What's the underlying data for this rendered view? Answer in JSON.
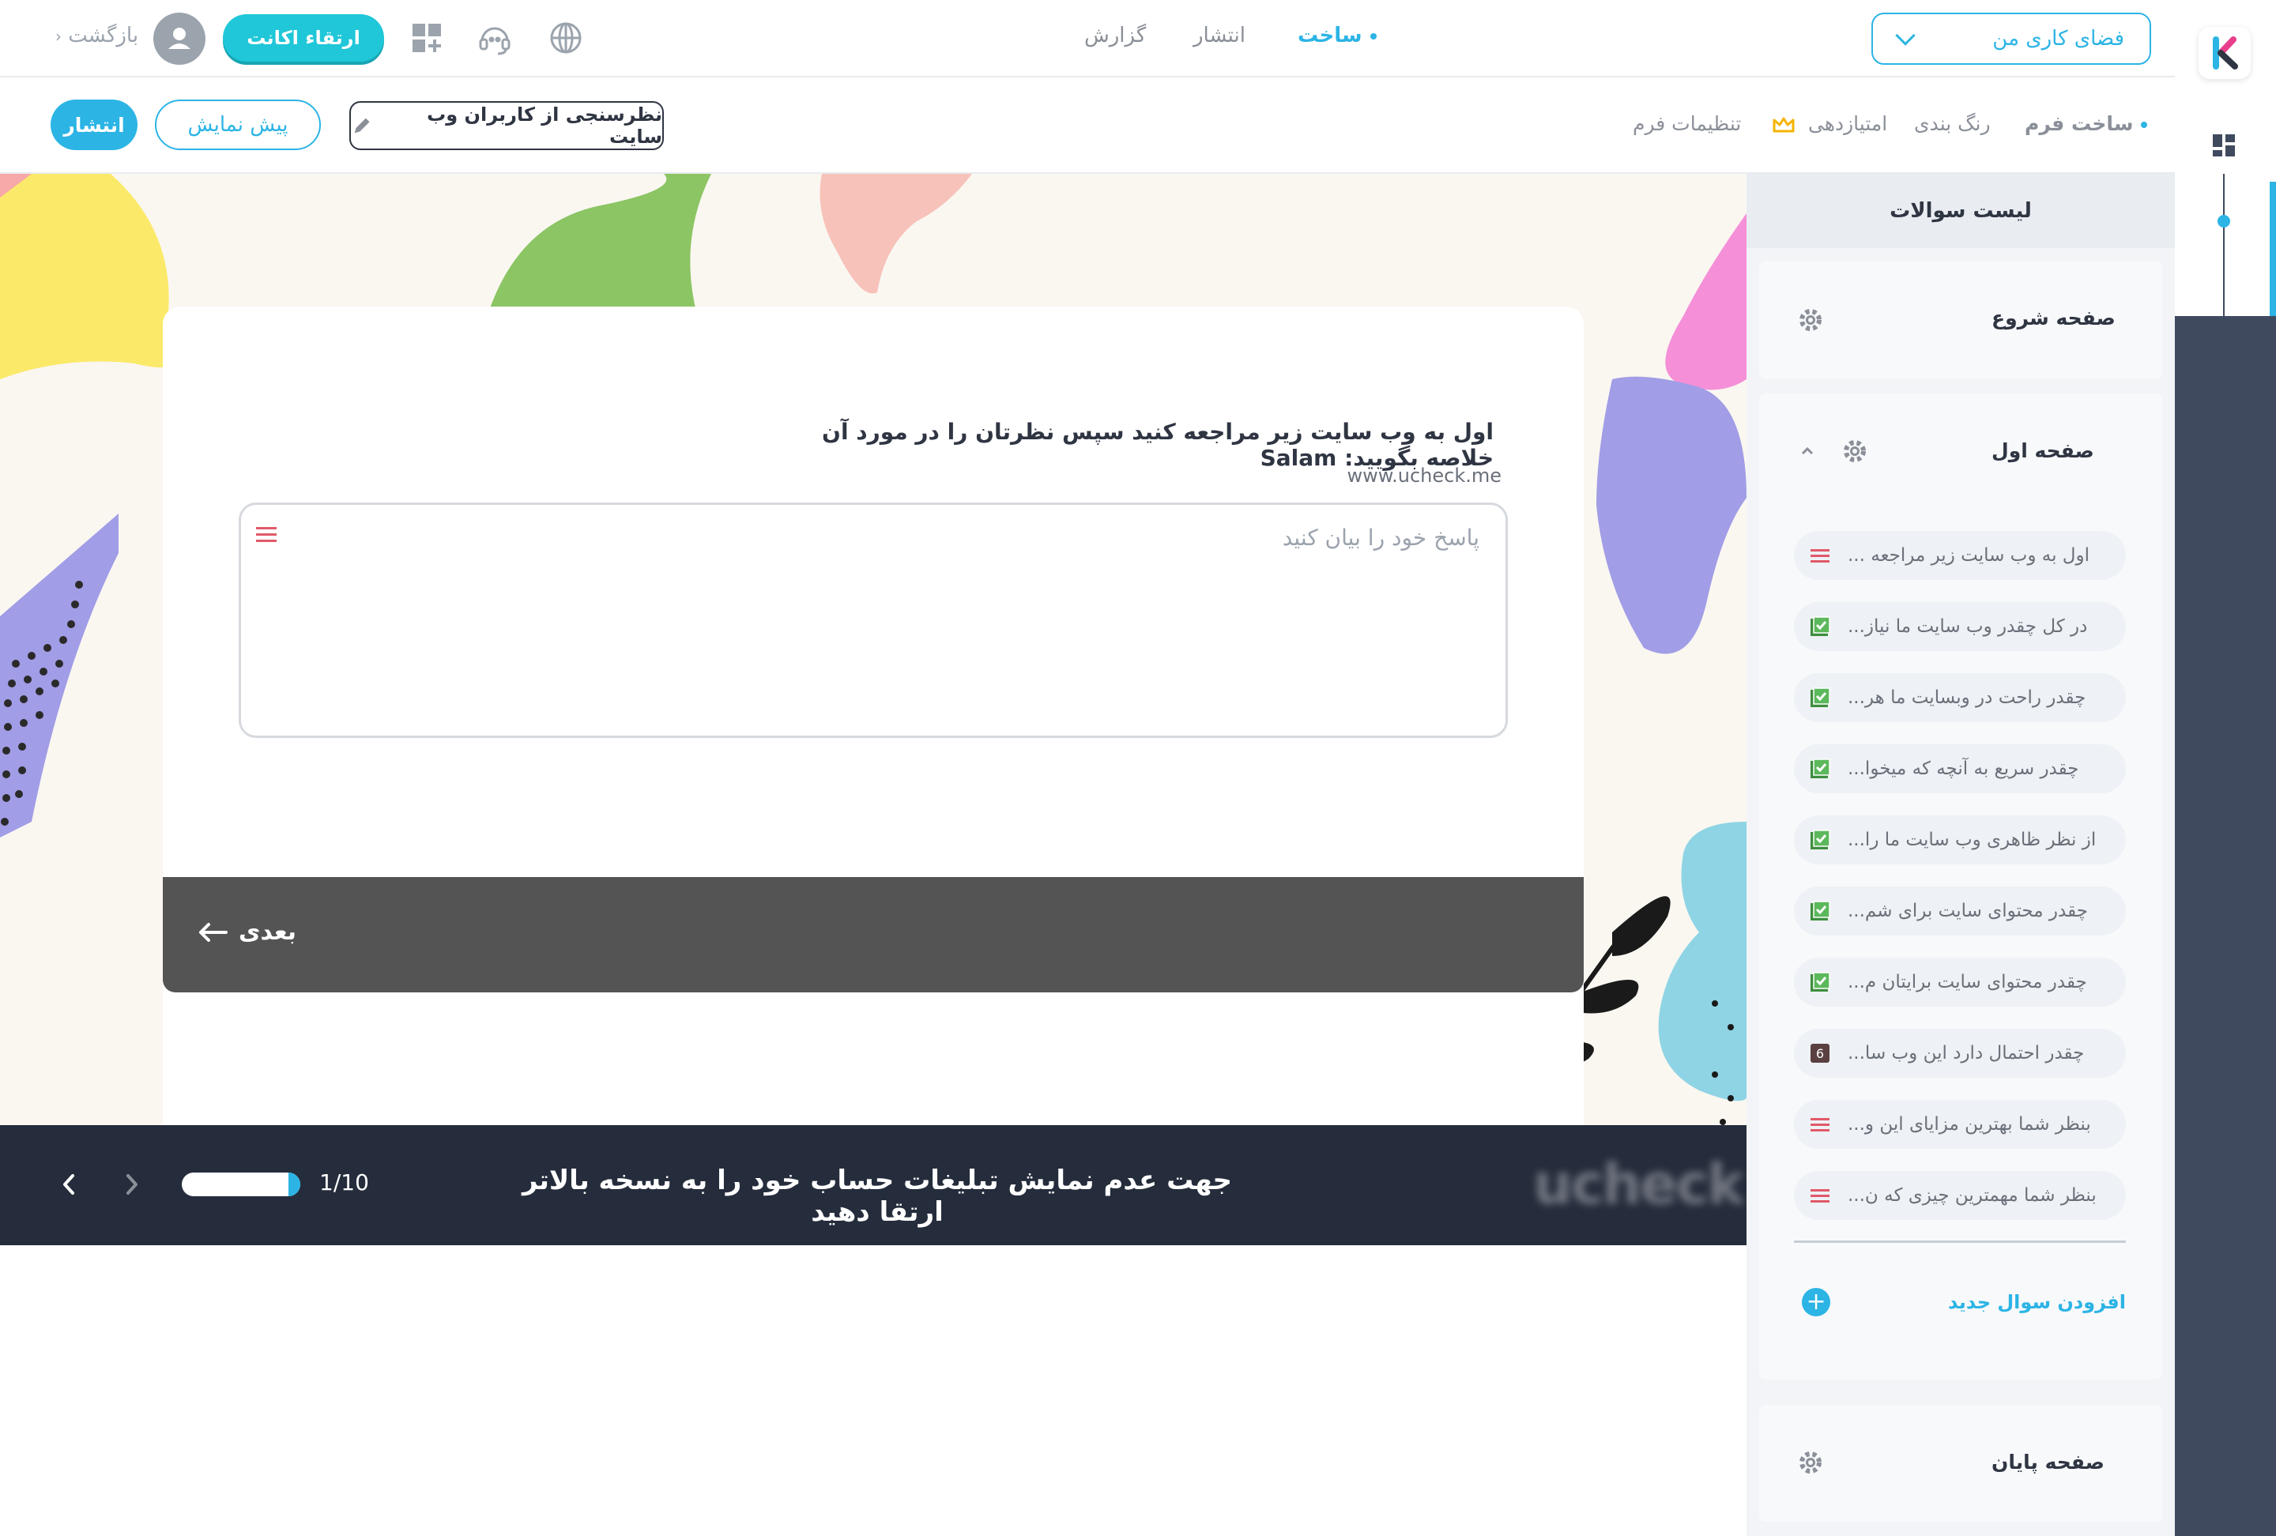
{
  "topbar": {
    "workspace": "فضای کاری من",
    "nav": [
      {
        "label": "ساخت",
        "active": true
      },
      {
        "label": "انتشار",
        "active": false
      },
      {
        "label": "گزارش",
        "active": false
      }
    ],
    "upgrade_label": "ارتقاء اکانت",
    "back_label": "بازگشت"
  },
  "subbar": {
    "tabs": [
      {
        "label": "ساخت فرم",
        "active": true
      },
      {
        "label": "رنگ بندی"
      },
      {
        "label": "امتیازدهی"
      },
      {
        "label": "تنظیمات فرم"
      }
    ],
    "form_name": "نظرسنجی از کاربران وب سایت",
    "preview_label": "پیش نمایش",
    "publish_label": "انتشار"
  },
  "question_panel": {
    "header": "لیست سوالات",
    "start_page": "صفحه شروع",
    "first_page": "صفحه اول",
    "end_page": "صفحه پایان",
    "add_question": "افزودن سوال جدید",
    "questions": [
      {
        "text": "اول به وب سایت زیر مراجعه ...",
        "icon": "text-lines-icon"
      },
      {
        "text": "در کل چقدر وب سایت ما نیاز...",
        "icon": "check-square-icon"
      },
      {
        "text": "چقدر راحت در وبسایت ما هر...",
        "icon": "check-square-icon"
      },
      {
        "text": "چقدر سریع به آنچه که میخوا...",
        "icon": "check-square-icon"
      },
      {
        "text": "از نظر ظاهری وب سایت ما را...",
        "icon": "check-square-icon"
      },
      {
        "text": "چقدر محتوای سایت برای شم...",
        "icon": "check-square-icon"
      },
      {
        "text": "چقدر محتوای سایت برایتان م...",
        "icon": "check-square-icon"
      },
      {
        "text": "چقدر احتمال دارد این وب سا...",
        "icon": "number-six-icon"
      },
      {
        "text": "بنظر شما بهترین مزایای این و...",
        "icon": "text-lines-icon"
      },
      {
        "text": "بنظر شما مهمترین چیزی که ن...",
        "icon": "text-lines-icon"
      }
    ]
  },
  "preview": {
    "question_title": "اول به وب سایت زیر مراجعه کنید سپس نظرتان را در مورد آن خلاصه بگویید: Salam",
    "question_sub": "www.ucheck.me",
    "answer_placeholder": "پاسخ خود را بیان کنید",
    "next_label": "بعدی"
  },
  "adbar": {
    "text": "جهت عدم نمایش تبلیغات حساب خود را به نسخه بالاتر ارتقا دهید",
    "logo": "ucheck",
    "page_count": "1/10",
    "progress": 0.1
  },
  "colors": {
    "accent": "#2cb4e5",
    "upgrade": "#1fc7d8",
    "rail": "#3f4a5f",
    "adbar": "#252d3c",
    "next_bar": "#545454"
  }
}
